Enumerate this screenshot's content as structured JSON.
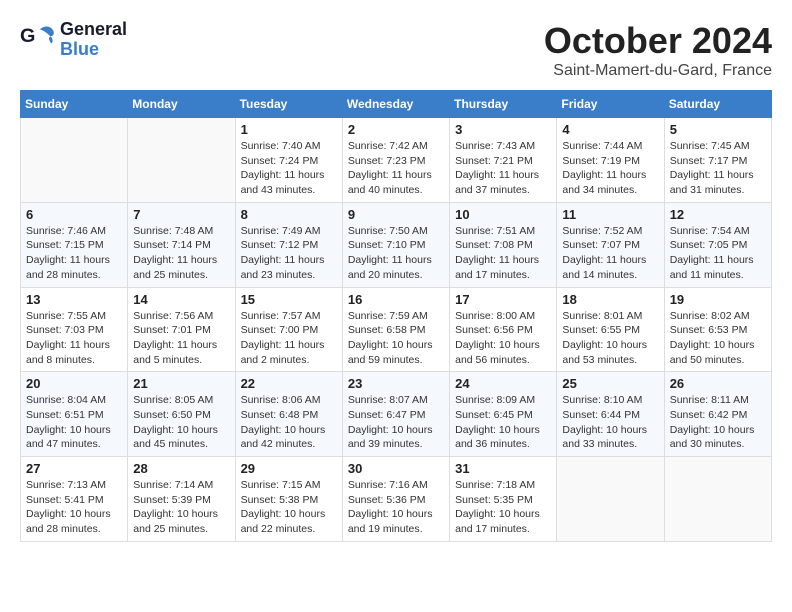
{
  "header": {
    "logo_general": "General",
    "logo_blue": "Blue",
    "month": "October 2024",
    "location": "Saint-Mamert-du-Gard, France"
  },
  "weekdays": [
    "Sunday",
    "Monday",
    "Tuesday",
    "Wednesday",
    "Thursday",
    "Friday",
    "Saturday"
  ],
  "weeks": [
    [
      {
        "day": "",
        "info": ""
      },
      {
        "day": "",
        "info": ""
      },
      {
        "day": "1",
        "info": "Sunrise: 7:40 AM\nSunset: 7:24 PM\nDaylight: 11 hours\nand 43 minutes."
      },
      {
        "day": "2",
        "info": "Sunrise: 7:42 AM\nSunset: 7:23 PM\nDaylight: 11 hours\nand 40 minutes."
      },
      {
        "day": "3",
        "info": "Sunrise: 7:43 AM\nSunset: 7:21 PM\nDaylight: 11 hours\nand 37 minutes."
      },
      {
        "day": "4",
        "info": "Sunrise: 7:44 AM\nSunset: 7:19 PM\nDaylight: 11 hours\nand 34 minutes."
      },
      {
        "day": "5",
        "info": "Sunrise: 7:45 AM\nSunset: 7:17 PM\nDaylight: 11 hours\nand 31 minutes."
      }
    ],
    [
      {
        "day": "6",
        "info": "Sunrise: 7:46 AM\nSunset: 7:15 PM\nDaylight: 11 hours\nand 28 minutes."
      },
      {
        "day": "7",
        "info": "Sunrise: 7:48 AM\nSunset: 7:14 PM\nDaylight: 11 hours\nand 25 minutes."
      },
      {
        "day": "8",
        "info": "Sunrise: 7:49 AM\nSunset: 7:12 PM\nDaylight: 11 hours\nand 23 minutes."
      },
      {
        "day": "9",
        "info": "Sunrise: 7:50 AM\nSunset: 7:10 PM\nDaylight: 11 hours\nand 20 minutes."
      },
      {
        "day": "10",
        "info": "Sunrise: 7:51 AM\nSunset: 7:08 PM\nDaylight: 11 hours\nand 17 minutes."
      },
      {
        "day": "11",
        "info": "Sunrise: 7:52 AM\nSunset: 7:07 PM\nDaylight: 11 hours\nand 14 minutes."
      },
      {
        "day": "12",
        "info": "Sunrise: 7:54 AM\nSunset: 7:05 PM\nDaylight: 11 hours\nand 11 minutes."
      }
    ],
    [
      {
        "day": "13",
        "info": "Sunrise: 7:55 AM\nSunset: 7:03 PM\nDaylight: 11 hours\nand 8 minutes."
      },
      {
        "day": "14",
        "info": "Sunrise: 7:56 AM\nSunset: 7:01 PM\nDaylight: 11 hours\nand 5 minutes."
      },
      {
        "day": "15",
        "info": "Sunrise: 7:57 AM\nSunset: 7:00 PM\nDaylight: 11 hours\nand 2 minutes."
      },
      {
        "day": "16",
        "info": "Sunrise: 7:59 AM\nSunset: 6:58 PM\nDaylight: 10 hours\nand 59 minutes."
      },
      {
        "day": "17",
        "info": "Sunrise: 8:00 AM\nSunset: 6:56 PM\nDaylight: 10 hours\nand 56 minutes."
      },
      {
        "day": "18",
        "info": "Sunrise: 8:01 AM\nSunset: 6:55 PM\nDaylight: 10 hours\nand 53 minutes."
      },
      {
        "day": "19",
        "info": "Sunrise: 8:02 AM\nSunset: 6:53 PM\nDaylight: 10 hours\nand 50 minutes."
      }
    ],
    [
      {
        "day": "20",
        "info": "Sunrise: 8:04 AM\nSunset: 6:51 PM\nDaylight: 10 hours\nand 47 minutes."
      },
      {
        "day": "21",
        "info": "Sunrise: 8:05 AM\nSunset: 6:50 PM\nDaylight: 10 hours\nand 45 minutes."
      },
      {
        "day": "22",
        "info": "Sunrise: 8:06 AM\nSunset: 6:48 PM\nDaylight: 10 hours\nand 42 minutes."
      },
      {
        "day": "23",
        "info": "Sunrise: 8:07 AM\nSunset: 6:47 PM\nDaylight: 10 hours\nand 39 minutes."
      },
      {
        "day": "24",
        "info": "Sunrise: 8:09 AM\nSunset: 6:45 PM\nDaylight: 10 hours\nand 36 minutes."
      },
      {
        "day": "25",
        "info": "Sunrise: 8:10 AM\nSunset: 6:44 PM\nDaylight: 10 hours\nand 33 minutes."
      },
      {
        "day": "26",
        "info": "Sunrise: 8:11 AM\nSunset: 6:42 PM\nDaylight: 10 hours\nand 30 minutes."
      }
    ],
    [
      {
        "day": "27",
        "info": "Sunrise: 7:13 AM\nSunset: 5:41 PM\nDaylight: 10 hours\nand 28 minutes."
      },
      {
        "day": "28",
        "info": "Sunrise: 7:14 AM\nSunset: 5:39 PM\nDaylight: 10 hours\nand 25 minutes."
      },
      {
        "day": "29",
        "info": "Sunrise: 7:15 AM\nSunset: 5:38 PM\nDaylight: 10 hours\nand 22 minutes."
      },
      {
        "day": "30",
        "info": "Sunrise: 7:16 AM\nSunset: 5:36 PM\nDaylight: 10 hours\nand 19 minutes."
      },
      {
        "day": "31",
        "info": "Sunrise: 7:18 AM\nSunset: 5:35 PM\nDaylight: 10 hours\nand 17 minutes."
      },
      {
        "day": "",
        "info": ""
      },
      {
        "day": "",
        "info": ""
      }
    ]
  ]
}
